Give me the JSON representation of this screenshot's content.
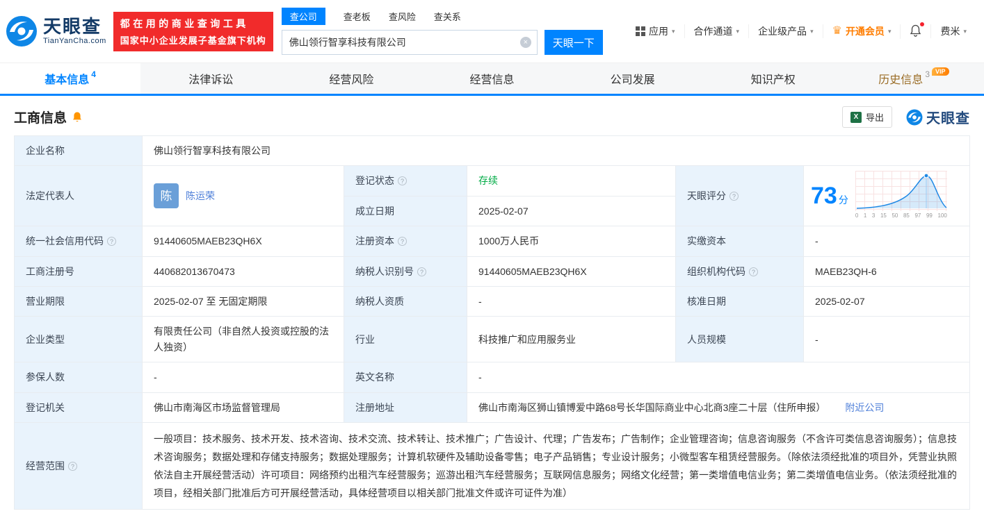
{
  "icons": {
    "help": "?",
    "caret": "▾",
    "clear": "×",
    "crown": "♛",
    "excel": "X"
  },
  "header": {
    "brand": "天眼查",
    "brand_domain": "TianYanCha.com",
    "slogan_line1": "都在用的商业查询工具",
    "slogan_line2": "国家中小企业发展子基金旗下机构",
    "search_tabs": [
      {
        "label": "查公司"
      },
      {
        "label": "查老板"
      },
      {
        "label": "查风险"
      },
      {
        "label": "查关系"
      }
    ],
    "search_value": "佛山领行智享科技有限公司",
    "search_button": "天眼一下",
    "menu": {
      "apps": "应用",
      "partner": "合作通道",
      "enterprise": "企业级产品",
      "vip": "开通会员",
      "user": "费米"
    }
  },
  "tabs": [
    {
      "label": "基本信息",
      "count": "4"
    },
    {
      "label": "法律诉讼",
      "count": ""
    },
    {
      "label": "经营风险",
      "count": ""
    },
    {
      "label": "经营信息",
      "count": ""
    },
    {
      "label": "公司发展",
      "count": ""
    },
    {
      "label": "知识产权",
      "count": ""
    },
    {
      "label": "历史信息",
      "count": "3",
      "vip": "VIP"
    }
  ],
  "section": {
    "title": "工商信息",
    "export_label": "导出",
    "logo_text": "天眼查"
  },
  "info": {
    "company_name_label": "企业名称",
    "company_name": "佛山领行智享科技有限公司",
    "legal_rep_label": "法定代表人",
    "legal_rep_avatar": "陈",
    "legal_rep_name": "陈运荣",
    "reg_status_label": "登记状态",
    "reg_status": "存续",
    "establish_date_label": "成立日期",
    "establish_date": "2025-02-07",
    "score_label": "天眼评分",
    "score_value": "73",
    "score_unit": "分",
    "credit_code_label": "统一社会信用代码",
    "credit_code": "91440605MAEB23QH6X",
    "reg_capital_label": "注册资本",
    "reg_capital": "1000万人民币",
    "paid_capital_label": "实缴资本",
    "paid_capital": "-",
    "reg_number_label": "工商注册号",
    "reg_number": "440682013670473",
    "taxpayer_id_label": "纳税人识别号",
    "taxpayer_id": "91440605MAEB23QH6X",
    "org_code_label": "组织机构代码",
    "org_code": "MAEB23QH-6",
    "business_term_label": "营业期限",
    "business_term": "2025-02-07 至 无固定期限",
    "taxpayer_quality_label": "纳税人资质",
    "taxpayer_quality": "-",
    "approval_date_label": "核准日期",
    "approval_date": "2025-02-07",
    "company_type_label": "企业类型",
    "company_type": "有限责任公司（非自然人投资或控股的法人独资）",
    "industry_label": "行业",
    "industry": "科技推广和应用服务业",
    "staff_size_label": "人员规模",
    "staff_size": "-",
    "insured_count_label": "参保人数",
    "insured_count": "-",
    "english_name_label": "英文名称",
    "english_name": "-",
    "registry_label": "登记机关",
    "registry": "佛山市南海区市场监督管理局",
    "address_label": "注册地址",
    "address": "佛山市南海区狮山镇博爱中路68号长华国际商业中心北商3座二十层（住所申报）",
    "nearby_link": "附近公司",
    "business_scope_label": "经营范围",
    "business_scope": "一般项目：技术服务、技术开发、技术咨询、技术交流、技术转让、技术推广；广告设计、代理；广告发布；广告制作；企业管理咨询；信息咨询服务（不含许可类信息咨询服务）；信息技术咨询服务；数据处理和存储支持服务；数据处理服务；计算机软硬件及辅助设备零售；电子产品销售；专业设计服务；小微型客车租赁经营服务。（除依法须经批准的项目外，凭营业执照依法自主开展经营活动）许可项目：网络预约出租汽车经营服务；巡游出租汽车经营服务；互联网信息服务；网络文化经营；第一类增值电信业务；第二类增值电信业务。（依法须经批准的项目，经相关部门批准后方可开展经营活动，具体经营项目以相关部门批准文件或许可证件为准）"
  },
  "score_chart": {
    "ticks": [
      "0",
      "1",
      "3",
      "15",
      "50",
      "85",
      "97",
      "99",
      "100"
    ]
  }
}
